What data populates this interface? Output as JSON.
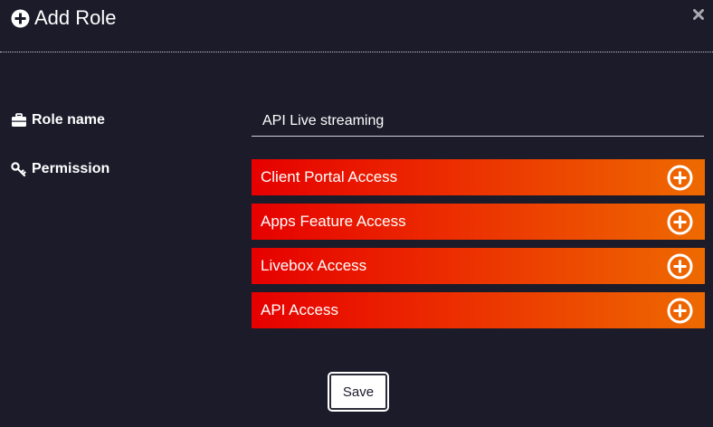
{
  "dialog": {
    "title": "Add Role",
    "title_icon": "plus-circle-icon",
    "close_icon": "close-icon"
  },
  "form": {
    "role_label": "Role name",
    "role_icon": "briefcase-icon",
    "role_value": "API Live streaming",
    "permission_label": "Permission",
    "permission_icon": "key-icon"
  },
  "permissions": [
    {
      "label": "Client Portal Access",
      "icon": "plus-circle-icon"
    },
    {
      "label": "Apps Feature Access",
      "icon": "plus-circle-icon"
    },
    {
      "label": "Livebox Access",
      "icon": "plus-circle-icon"
    },
    {
      "label": "API Access",
      "icon": "plus-circle-icon"
    }
  ],
  "actions": {
    "save_label": "Save"
  },
  "colors": {
    "background": "#1b1b2a",
    "accent_start": "#e60000",
    "accent_end": "#ee6a00",
    "text": "#ffffff"
  }
}
